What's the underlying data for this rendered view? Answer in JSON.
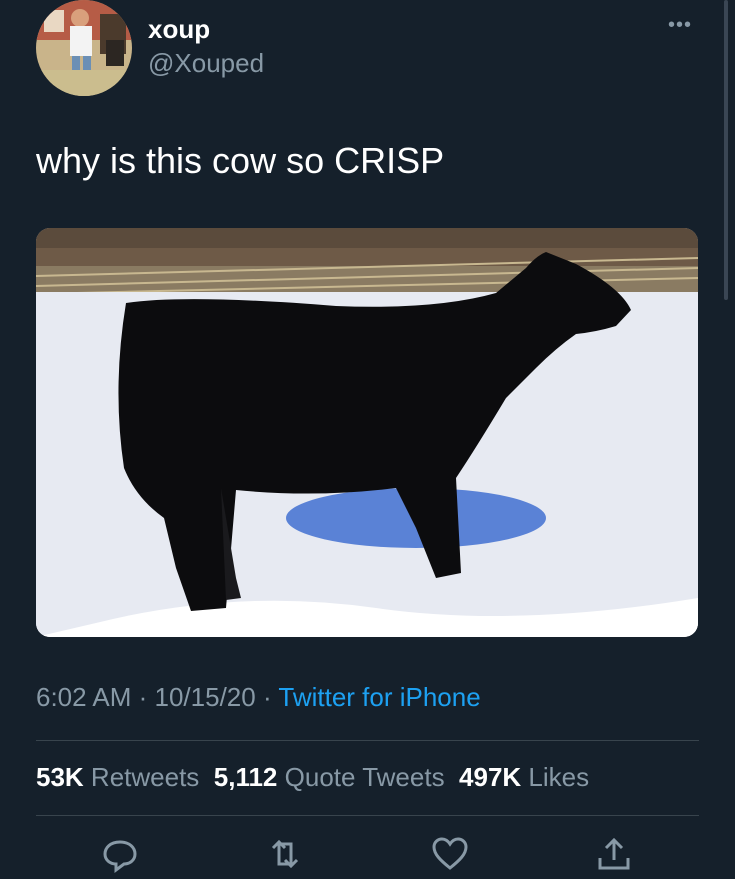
{
  "user": {
    "name": "xoup",
    "handle": "@Xouped"
  },
  "tweet": {
    "text": "why is this cow so CRISP"
  },
  "meta": {
    "time": "6:02 AM",
    "date": "10/15/20",
    "source": "Twitter for iPhone",
    "sep": " · "
  },
  "stats": {
    "retweets_count": "53K",
    "retweets_label": " Retweets",
    "quotes_count": "5,112",
    "quotes_label": " Quote Tweets",
    "likes_count": "497K",
    "likes_label": " Likes"
  },
  "actions": [
    "reply-icon",
    "retweet-icon",
    "like-icon",
    "share-icon"
  ],
  "colors": {
    "background": "#15202b",
    "secondary_text": "#8899a6",
    "link": "#1da1f2",
    "divider": "#38444d"
  }
}
